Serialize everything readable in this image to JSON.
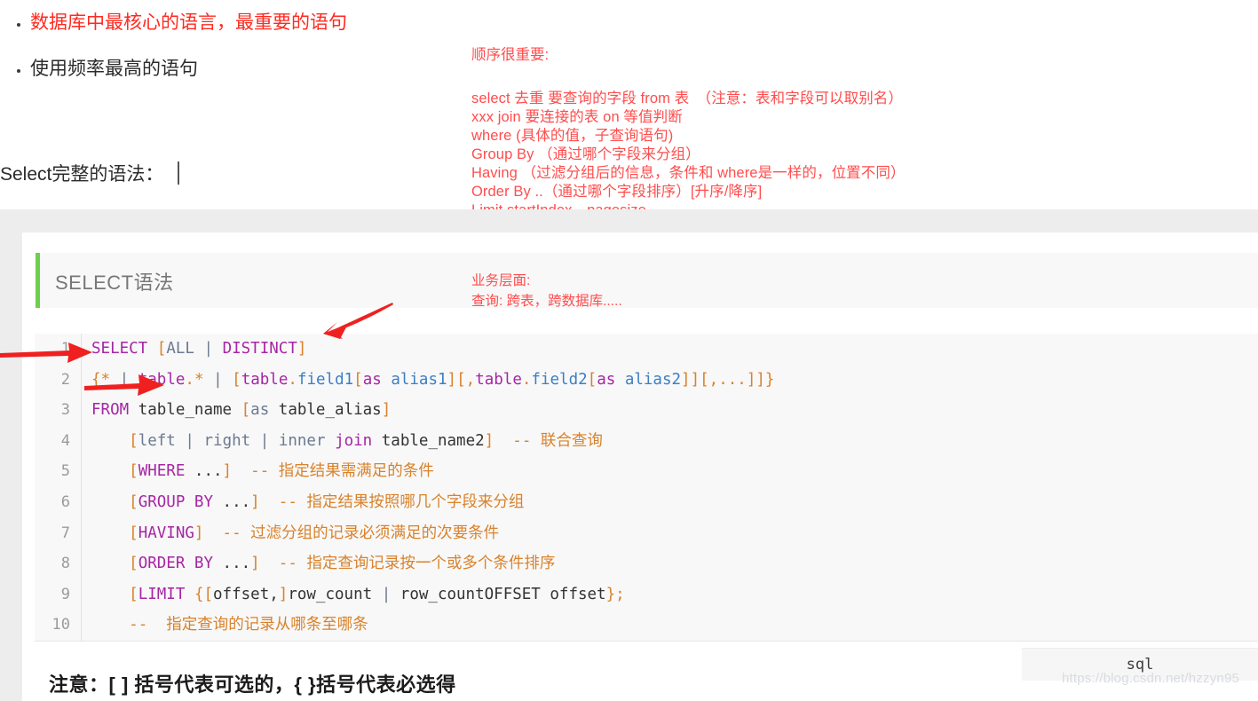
{
  "notes": {
    "bullets": [
      {
        "text": "数据库中最核心的语言，最重要的语句",
        "color": "#ff2a20"
      },
      {
        "text": "使用频率最高的语句",
        "color": "#2b2b2b"
      }
    ],
    "syntax_label": "Select完整的语法："
  },
  "annotation_order": {
    "heading": "顺序很重要:",
    "lines": [
      "select 去重 要查询的字段 from 表　（注意：表和字段可以取别名）",
      "xxx join 要连接的表  on  等值判断",
      "where (具体的值，子查询语句)",
      "Group By  （通过哪个字段来分组）",
      "Having  （过滤分组后的信息，条件和 where是一样的，位置不同）",
      "Order By ..（通过哪个字段排序）[升序/降序]",
      "Limit  startIndex，pagesize"
    ],
    "color": "#ff4d4d"
  },
  "annotation_business": {
    "lines": [
      "业务层面:",
      "查询: 跨表，跨数据库....."
    ],
    "color": "#ff4d4d"
  },
  "article": {
    "heading": "SELECT语法",
    "accent_color": "#6ece4e",
    "bottom_note": "注意：[ ] 括号代表可选的，{ }括号代表必选得",
    "language_badge": "sql",
    "watermark": "https://blog.csdn.net/hzzyn95"
  },
  "code": {
    "lines": [
      {
        "no": "1",
        "tokens": [
          {
            "t": "SELECT",
            "c": "kw"
          },
          {
            "t": " ",
            "c": "pl"
          },
          {
            "t": "[",
            "c": "br"
          },
          {
            "t": "ALL",
            "c": "kw2"
          },
          {
            "t": " ",
            "c": "pl"
          },
          {
            "t": "|",
            "c": "op"
          },
          {
            "t": " ",
            "c": "pl"
          },
          {
            "t": "DISTINCT",
            "c": "kw"
          },
          {
            "t": "]",
            "c": "br"
          }
        ]
      },
      {
        "no": "2",
        "tokens": [
          {
            "t": "{",
            "c": "br"
          },
          {
            "t": "*",
            "c": "br"
          },
          {
            "t": " ",
            "c": "pl"
          },
          {
            "t": "|",
            "c": "op"
          },
          {
            "t": " ",
            "c": "pl"
          },
          {
            "t": "table",
            "c": "kw"
          },
          {
            "t": ".",
            "c": "br"
          },
          {
            "t": "*",
            "c": "br"
          },
          {
            "t": " ",
            "c": "pl"
          },
          {
            "t": "|",
            "c": "op"
          },
          {
            "t": " ",
            "c": "pl"
          },
          {
            "t": "[",
            "c": "br"
          },
          {
            "t": "table",
            "c": "kw"
          },
          {
            "t": ".",
            "c": "br"
          },
          {
            "t": "field1",
            "c": "id"
          },
          {
            "t": "[",
            "c": "br"
          },
          {
            "t": "as",
            "c": "kw"
          },
          {
            "t": " ",
            "c": "pl"
          },
          {
            "t": "alias1",
            "c": "id"
          },
          {
            "t": "]",
            "c": "br"
          },
          {
            "t": "[",
            "c": "br"
          },
          {
            "t": ",",
            "c": "br"
          },
          {
            "t": "table",
            "c": "kw"
          },
          {
            "t": ".",
            "c": "br"
          },
          {
            "t": "field2",
            "c": "id"
          },
          {
            "t": "[",
            "c": "br"
          },
          {
            "t": "as",
            "c": "kw"
          },
          {
            "t": " ",
            "c": "pl"
          },
          {
            "t": "alias2",
            "c": "id"
          },
          {
            "t": "]]",
            "c": "br"
          },
          {
            "t": "[",
            "c": "br"
          },
          {
            "t": ",...",
            "c": "br"
          },
          {
            "t": "]]}",
            "c": "br"
          }
        ]
      },
      {
        "no": "3",
        "tokens": [
          {
            "t": "FROM",
            "c": "kw"
          },
          {
            "t": " ",
            "c": "pl"
          },
          {
            "t": "table_name",
            "c": "pl"
          },
          {
            "t": " ",
            "c": "pl"
          },
          {
            "t": "[",
            "c": "br"
          },
          {
            "t": "as",
            "c": "kw2"
          },
          {
            "t": " ",
            "c": "pl"
          },
          {
            "t": "table_alias",
            "c": "pl"
          },
          {
            "t": "]",
            "c": "br"
          }
        ]
      },
      {
        "no": "4",
        "tokens": [
          {
            "t": "    ",
            "c": "pl"
          },
          {
            "t": "[",
            "c": "br"
          },
          {
            "t": "left",
            "c": "kw2"
          },
          {
            "t": " ",
            "c": "pl"
          },
          {
            "t": "|",
            "c": "op"
          },
          {
            "t": " ",
            "c": "pl"
          },
          {
            "t": "right",
            "c": "kw2"
          },
          {
            "t": " ",
            "c": "pl"
          },
          {
            "t": "|",
            "c": "op"
          },
          {
            "t": " ",
            "c": "pl"
          },
          {
            "t": "inner",
            "c": "kw2"
          },
          {
            "t": " ",
            "c": "pl"
          },
          {
            "t": "join",
            "c": "kw"
          },
          {
            "t": " ",
            "c": "pl"
          },
          {
            "t": "table_name2",
            "c": "pl"
          },
          {
            "t": "]",
            "c": "br"
          },
          {
            "t": "  ",
            "c": "pl"
          },
          {
            "t": "-- 联合查询",
            "c": "cm"
          }
        ]
      },
      {
        "no": "5",
        "tokens": [
          {
            "t": "    ",
            "c": "pl"
          },
          {
            "t": "[",
            "c": "br"
          },
          {
            "t": "WHERE",
            "c": "kw"
          },
          {
            "t": " ...",
            "c": "pl"
          },
          {
            "t": "]",
            "c": "br"
          },
          {
            "t": "  ",
            "c": "pl"
          },
          {
            "t": "-- 指定结果需满足的条件",
            "c": "cm"
          }
        ]
      },
      {
        "no": "6",
        "tokens": [
          {
            "t": "    ",
            "c": "pl"
          },
          {
            "t": "[",
            "c": "br"
          },
          {
            "t": "GROUP BY",
            "c": "kw"
          },
          {
            "t": " ...",
            "c": "pl"
          },
          {
            "t": "]",
            "c": "br"
          },
          {
            "t": "  ",
            "c": "pl"
          },
          {
            "t": "-- 指定结果按照哪几个字段来分组",
            "c": "cm"
          }
        ]
      },
      {
        "no": "7",
        "tokens": [
          {
            "t": "    ",
            "c": "pl"
          },
          {
            "t": "[",
            "c": "br"
          },
          {
            "t": "HAVING",
            "c": "kw"
          },
          {
            "t": "]",
            "c": "br"
          },
          {
            "t": "  ",
            "c": "pl"
          },
          {
            "t": "-- 过滤分组的记录必须满足的次要条件",
            "c": "cm"
          }
        ]
      },
      {
        "no": "8",
        "tokens": [
          {
            "t": "    ",
            "c": "pl"
          },
          {
            "t": "[",
            "c": "br"
          },
          {
            "t": "ORDER BY",
            "c": "kw"
          },
          {
            "t": " ...",
            "c": "pl"
          },
          {
            "t": "]",
            "c": "br"
          },
          {
            "t": "  ",
            "c": "pl"
          },
          {
            "t": "-- 指定查询记录按一个或多个条件排序",
            "c": "cm"
          }
        ]
      },
      {
        "no": "9",
        "tokens": [
          {
            "t": "    ",
            "c": "pl"
          },
          {
            "t": "[",
            "c": "br"
          },
          {
            "t": "LIMIT",
            "c": "kw"
          },
          {
            "t": " ",
            "c": "pl"
          },
          {
            "t": "{[",
            "c": "br"
          },
          {
            "t": "offset,",
            "c": "pl"
          },
          {
            "t": "]",
            "c": "br"
          },
          {
            "t": "row_count",
            "c": "pl"
          },
          {
            "t": " ",
            "c": "pl"
          },
          {
            "t": "|",
            "c": "op"
          },
          {
            "t": " ",
            "c": "pl"
          },
          {
            "t": "row_countOFFSET offset",
            "c": "pl"
          },
          {
            "t": "};",
            "c": "br"
          }
        ]
      },
      {
        "no": "10",
        "tokens": [
          {
            "t": "    ",
            "c": "pl"
          },
          {
            "t": "--  指定查询的记录从哪条至哪条",
            "c": "cm"
          }
        ]
      }
    ]
  }
}
